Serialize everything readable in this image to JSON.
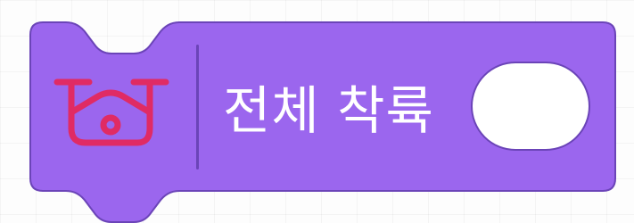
{
  "block": {
    "label": "전체 착륙",
    "input_value": "",
    "icon": "drone-camera-icon",
    "colors": {
      "fill": "#9b66ee",
      "stroke": "#6b44b8",
      "icon": "#e02b64",
      "text": "#ffffff",
      "slot": "#ffffff"
    }
  }
}
